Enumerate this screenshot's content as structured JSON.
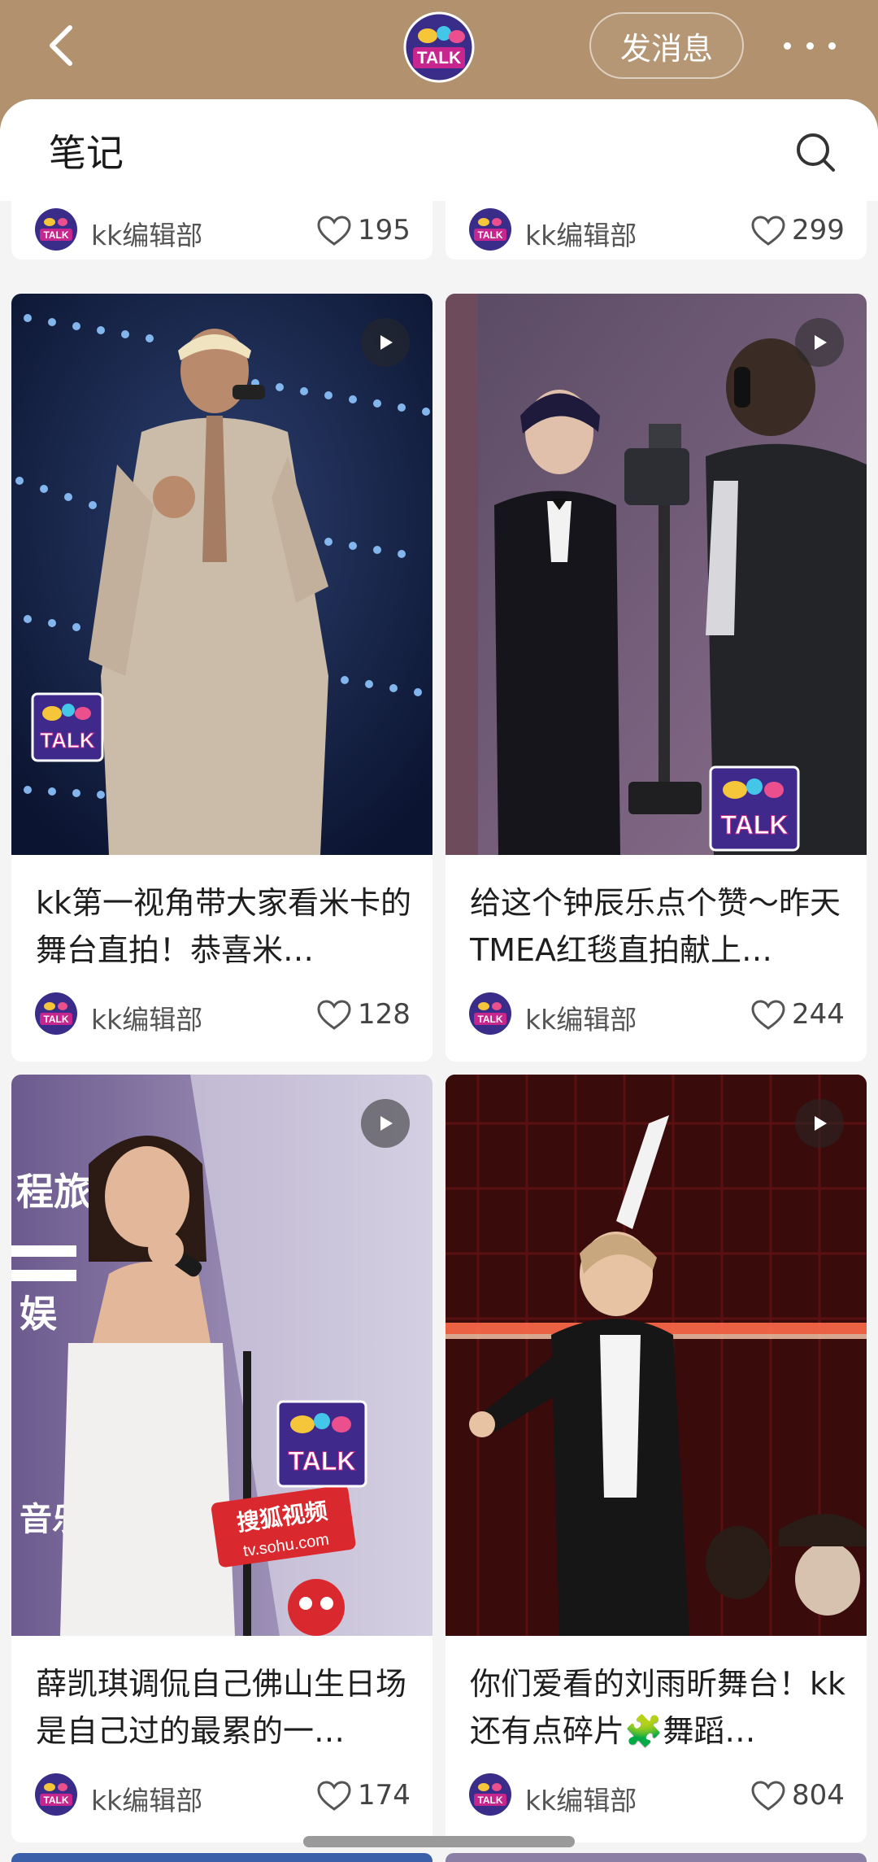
{
  "header": {
    "message_label": "发消息",
    "logo_text": "TALK"
  },
  "sheet": {
    "title": "笔记"
  },
  "top_partial_cards": [
    {
      "author": "kk编辑部",
      "likes": "195"
    },
    {
      "author": "kk编辑部",
      "likes": "299"
    }
  ],
  "cards": [
    {
      "title": "kk第一视角带大家看米卡的舞台直拍！恭喜米…",
      "author": "kk编辑部",
      "likes": "128",
      "watermark": "TALK"
    },
    {
      "title": "给这个钟辰乐点个赞～昨天TMEA红毯直拍献上…",
      "author": "kk编辑部",
      "likes": "244",
      "watermark": "TALK"
    },
    {
      "title": "薛凯琪调侃自己佛山生日场是自己过的最累的一…",
      "author": "kk编辑部",
      "likes": "174",
      "watermark": "TALK",
      "overlay_text": [
        "程旅",
        "娱",
        "音乐",
        "搜狐视频",
        "tv.sohu.com"
      ]
    },
    {
      "title": "你们爱看的刘雨昕舞台！kk还有点碎片🧩舞蹈…",
      "author": "kk编辑部",
      "likes": "804"
    }
  ],
  "icons": {
    "back": "chevron-left-icon",
    "more": "more-dots-icon",
    "search": "search-icon",
    "like": "heart-icon",
    "play": "play-icon"
  }
}
